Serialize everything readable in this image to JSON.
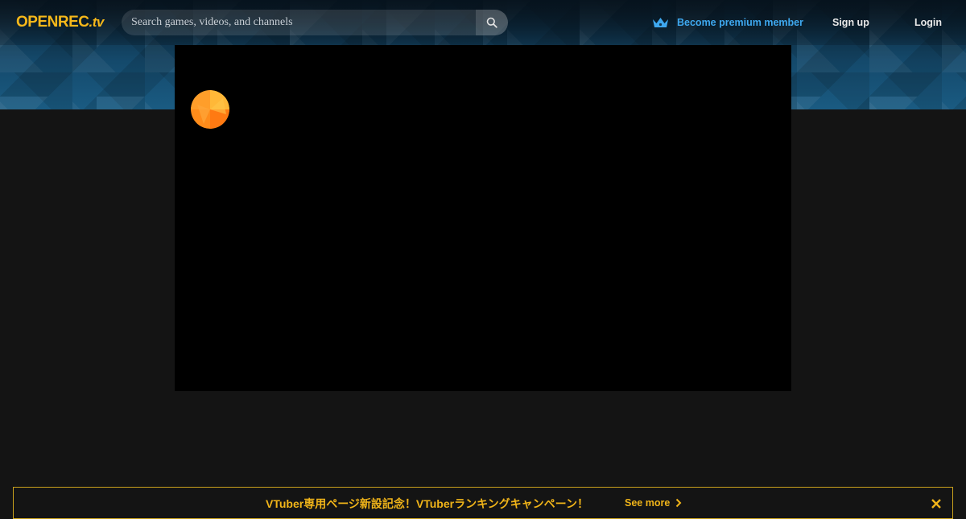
{
  "header": {
    "logo_main": "OPENREC",
    "logo_tld": ".tv",
    "search": {
      "placeholder": "Search games, videos, and channels"
    },
    "premium_label": "Become premium member",
    "signup_label": "Sign up",
    "login_label": "Login"
  },
  "banner": {
    "text": "VTuber専用ページ新設記念！VTuberランキングキャンペーン！",
    "more_label": "See more"
  },
  "icons": {
    "search": "search-icon",
    "crown": "crown-icon",
    "spinner": "loading-spinner-icon",
    "chevron": "chevron-right-icon",
    "close": "close-icon"
  },
  "colors": {
    "brand": "#f6b81a",
    "premium": "#3ea8ef",
    "banner_accent": "#f0b419",
    "background": "#141414"
  }
}
